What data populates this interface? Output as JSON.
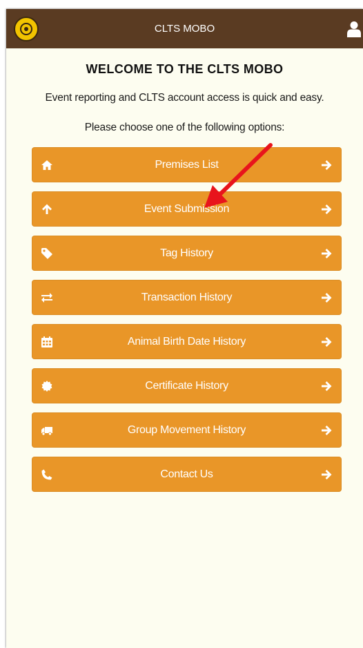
{
  "header": {
    "title": "CLTS MOBO"
  },
  "welcome": {
    "heading": "WELCOME TO THE CLTS MOBO",
    "intro": "Event reporting and CLTS account access is quick and easy.",
    "prompt": "Please choose one of the following options:"
  },
  "menu": [
    {
      "label": "Premises List",
      "icon": "home-icon"
    },
    {
      "label": "Event Submission",
      "icon": "arrow-up-icon"
    },
    {
      "label": "Tag History",
      "icon": "tag-icon"
    },
    {
      "label": "Transaction History",
      "icon": "exchange-icon"
    },
    {
      "label": "Animal Birth Date History",
      "icon": "calendar-icon"
    },
    {
      "label": "Certificate History",
      "icon": "certificate-icon"
    },
    {
      "label": "Group Movement History",
      "icon": "truck-icon"
    },
    {
      "label": "Contact Us",
      "icon": "phone-icon"
    }
  ],
  "colors": {
    "header": "#5a3b22",
    "button": "#e99628",
    "background": "#fdfdf0",
    "annotation": "#e8141c"
  }
}
